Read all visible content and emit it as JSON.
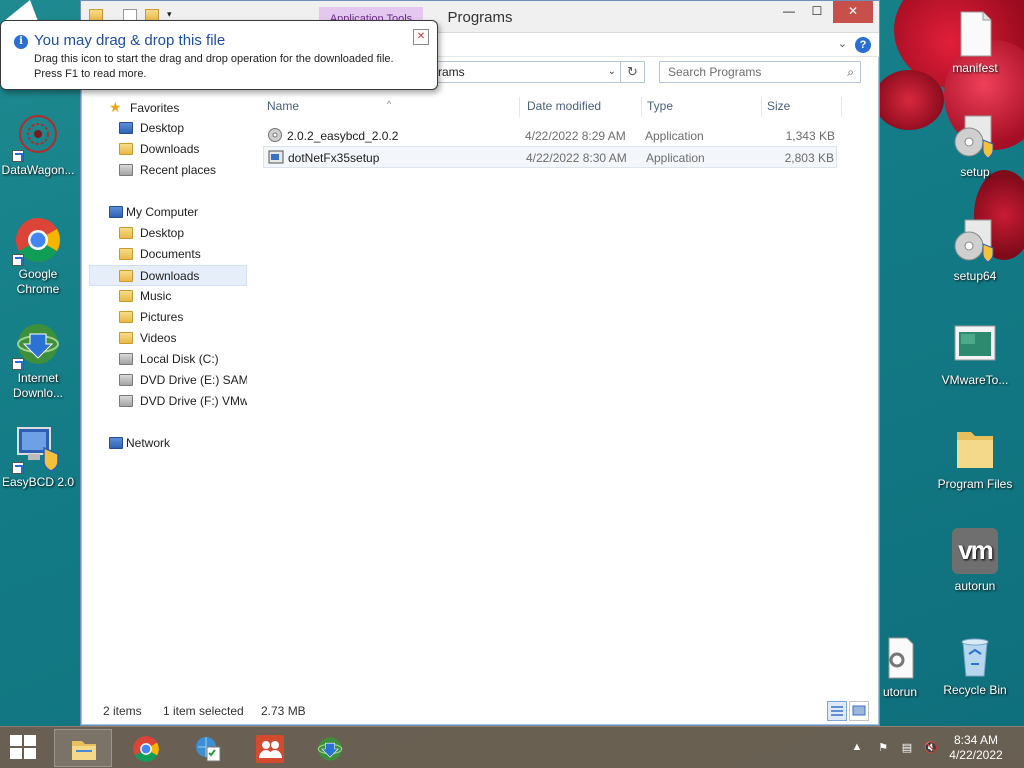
{
  "explorer": {
    "title": "Programs",
    "context_tab": "Application Tools",
    "address_text": "rams",
    "search_placeholder": "Search Programs",
    "columns": [
      "Name",
      "Date modified",
      "Type",
      "Size"
    ],
    "files": [
      {
        "name": "2.0.2_easybcd_2.0.2",
        "date": "4/22/2022 8:29 AM",
        "type": "Application",
        "size": "1,343 KB",
        "selected": false
      },
      {
        "name": "dotNetFx35setup",
        "date": "4/22/2022 8:30 AM",
        "type": "Application",
        "size": "2,803 KB",
        "selected": true
      }
    ],
    "nav": {
      "favorites": "Favorites",
      "fav_items": [
        "Desktop",
        "Downloads",
        "Recent places"
      ],
      "computer": "My Computer",
      "comp_items": [
        "Desktop",
        "Documents",
        "Downloads",
        "Music",
        "Pictures",
        "Videos",
        "Local Disk (C:)",
        "DVD Drive (E:) SAMS",
        "DVD Drive (F:) VMwa"
      ],
      "network": "Network"
    },
    "status": {
      "items": "2 items",
      "selected": "1 item selected",
      "size": "2.73 MB"
    }
  },
  "balloon": {
    "title": "You may drag & drop this file",
    "line1": "Drag this icon to start the drag and drop operation for the downloaded file.",
    "line2": "Press F1 to read more."
  },
  "desktop_left": [
    "DataWagon...",
    "Google Chrome",
    "Internet Downlo...",
    "EasyBCD 2.0"
  ],
  "desktop_right": [
    "manifest",
    "setup",
    "setup64",
    "VMwareTo...",
    "Program Files",
    "autorun",
    "utorun",
    "Recycle Bin"
  ],
  "clock": {
    "time": "8:34 AM",
    "date": "4/22/2022"
  },
  "colors": {
    "accent": "#1f4ea8",
    "close_red": "#c7504a",
    "desktop": "#137c86"
  }
}
